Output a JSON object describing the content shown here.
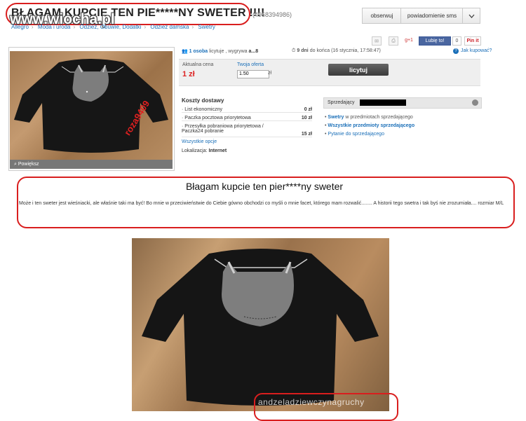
{
  "header": {
    "title": "BŁAGAM KUPCIE TEN PIE*****NY SWETER !!!!",
    "item_id": "(4968394986)",
    "watermark": "www.wiocha.pl",
    "breadcrumbs": [
      "Allegro",
      "Moda i uroda",
      "Odzież, Obuwie, Dodatki",
      "Odzież damska",
      "Swetry"
    ],
    "buttons": {
      "watch": "obserwuj",
      "sms": "powiadomienie sms",
      "more_icon": "chevron-down-icon"
    }
  },
  "social": {
    "gplus": "g+1",
    "like": "Lubię to!",
    "like_count": "0",
    "pinit": "Pin it"
  },
  "gallery": {
    "zoom_label": "Powiększ",
    "stamp": "roza9409"
  },
  "auction": {
    "bidders_count": "1 osoba",
    "bidders_text": "licytuje , wygrywa",
    "winner": "a...8",
    "time_left": "9 dni",
    "time_text": "do końca (16 stycznia, 17:58:47)",
    "help": "Jak kupować?",
    "current_price_label": "Aktualna cena",
    "current_price": "1 zł",
    "offer_label": "Twoja oferta",
    "offer_value": "1.50",
    "offer_unit": "zł",
    "bid_button": "licytuj"
  },
  "shipping": {
    "title": "Koszty dostawy",
    "rows": [
      {
        "label": "List ekonomiczny",
        "value": "0 zł"
      },
      {
        "label": "Paczka pocztowa priorytetowa",
        "value": "10 zł"
      },
      {
        "label": "Przesyłka pobraniowa priorytetowa / Paczka24 pobranie",
        "value": "15 zł"
      }
    ],
    "all_options": "Wszystkie opcje",
    "location_label": "Lokalizacja:",
    "location": "Internet"
  },
  "seller": {
    "label": "Sprzedający",
    "links": [
      {
        "strong": "Swetry",
        "rest": "w przedmiotach sprzedającego"
      },
      {
        "strong": "Wszystkie przedmioty sprzedającego",
        "rest": ""
      },
      {
        "strong": "",
        "rest": "Pytanie do sprzedającego"
      }
    ]
  },
  "description": {
    "title": "Błagam kupcie ten pier****ny sweter",
    "text": "Może i ten sweter jest wieśniacki, ale właśnie taki ma być! Bo mnie w przeciwieństwie do Ciebie gówno obchodzi co myśli o mnie facet, którego mam rozwalić........ A historii tego swetra i tak byś nie zrozumiała.... rozmiar M/L",
    "photo_watermark": "andzeladziewczynagruchy"
  }
}
